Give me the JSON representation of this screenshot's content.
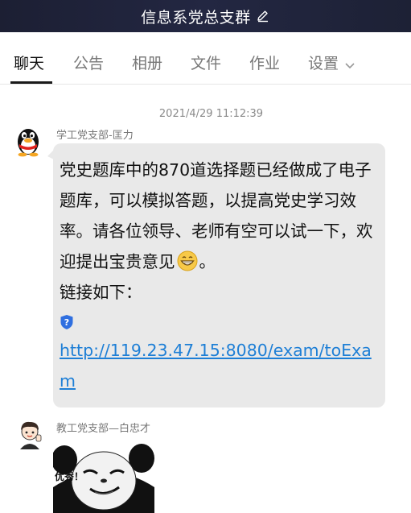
{
  "header": {
    "title": "信息系党总支群",
    "edit_icon": "edit-pencil-icon",
    "background": "#1f2339"
  },
  "tabs": [
    {
      "label": "聊天",
      "active": true
    },
    {
      "label": "公告",
      "active": false
    },
    {
      "label": "相册",
      "active": false
    },
    {
      "label": "文件",
      "active": false
    },
    {
      "label": "作业",
      "active": false
    },
    {
      "label": "设置",
      "active": false,
      "icon": "chevron-down-icon"
    }
  ],
  "chat": {
    "timestamp": "2021/4/29 11:12:39",
    "messages": [
      {
        "sender": "学工党支部-匡力",
        "avatar_icon": "penguin-avatar-icon",
        "text_before_emoji": "党史题库中的870道选择题已经做成了电子题库，可以模拟答题，以提高党史学习效率。请各位领导、老师有空可以试一下，欢迎提出宝贵意见",
        "emoji": "grin-emoji-icon",
        "text_after_emoji": "。",
        "link_intro": "链接如下：",
        "link_icon": "security-shield-icon",
        "link_url": "http://119.23.47.15:8080/exam/toExam",
        "bubble_color": "#e9e9e9",
        "link_color": "#1e7fd6"
      },
      {
        "sender": "教工党支部—白忠才",
        "avatar_icon": "cartoon-avatar-icon",
        "sticker_icon": "panda-meme-sticker-icon",
        "sticker_text": "优秀！"
      }
    ]
  }
}
